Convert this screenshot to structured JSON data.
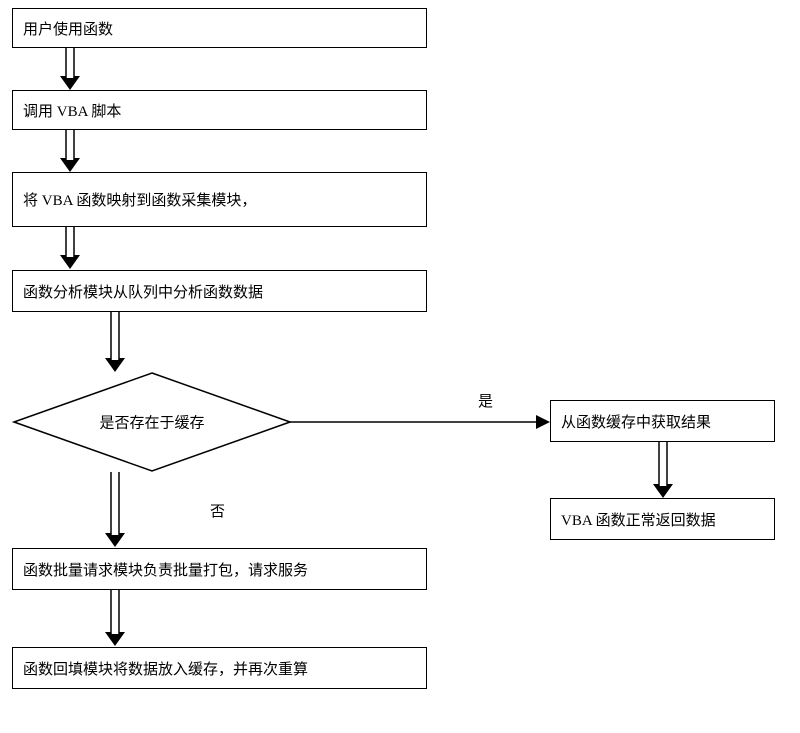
{
  "flowchart": {
    "box1": "用户使用函数",
    "box2": "调用 VBA 脚本",
    "box3": "将 VBA 函数映射到函数采集模块，",
    "box4": "函数分析模块从队列中分析函数数据",
    "decision": "是否存在于缓存",
    "label_yes": "是",
    "label_no": "否",
    "box5": "函数批量请求模块负责批量打包，请求服务",
    "box6": "函数回填模块将数据放入缓存，并再次重算",
    "box7": "从函数缓存中获取结果",
    "box8": "VBA 函数正常返回数据"
  }
}
